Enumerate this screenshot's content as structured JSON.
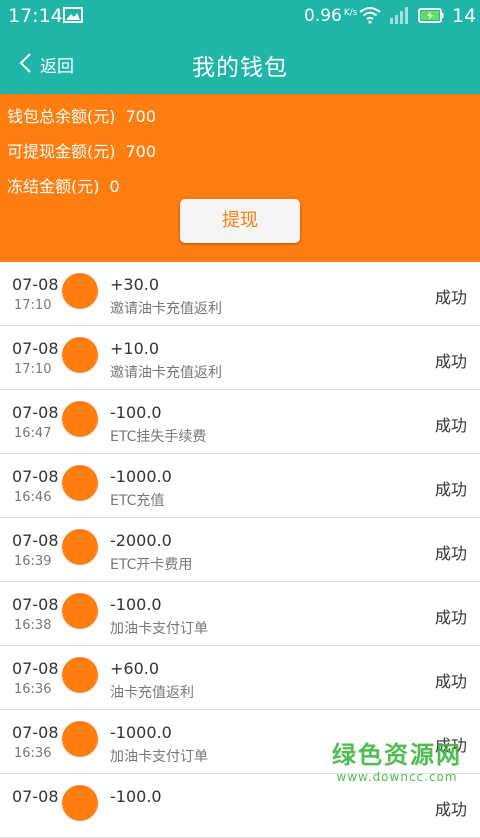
{
  "colors": {
    "header": "#1fb5a8",
    "accent": "#ff7e0f",
    "background": "#f2f2f2",
    "watermark": "#3fb53f"
  },
  "status_bar": {
    "time": "17:14",
    "net_speed": "0.96",
    "net_speed_unit": "K/s",
    "battery_level": "14",
    "icons": [
      "image-icon",
      "wifi-icon",
      "signal-icon",
      "battery-icon"
    ]
  },
  "nav": {
    "back_label": "返回",
    "title": "我的钱包",
    "back_icon": "chevron-left-icon"
  },
  "balance": {
    "total_label": "钱包总余额(元)",
    "total_value": "700",
    "withdrawable_label": "可提现金额(元)",
    "withdrawable_value": "700",
    "frozen_label": "冻结金额(元)",
    "frozen_value": "0",
    "withdraw_button": "提现"
  },
  "transactions": [
    {
      "date": "07-08",
      "time": "17:10",
      "amount": "+30.0",
      "desc": "邀请油卡充值返利",
      "status": "成功"
    },
    {
      "date": "07-08",
      "time": "17:10",
      "amount": "+10.0",
      "desc": "邀请油卡充值返利",
      "status": "成功"
    },
    {
      "date": "07-08",
      "time": "16:47",
      "amount": "-100.0",
      "desc": "ETC挂失手续费",
      "status": "成功"
    },
    {
      "date": "07-08",
      "time": "16:46",
      "amount": "-1000.0",
      "desc": "ETC充值",
      "status": "成功"
    },
    {
      "date": "07-08",
      "time": "16:39",
      "amount": "-2000.0",
      "desc": "ETC开卡费用",
      "status": "成功"
    },
    {
      "date": "07-08",
      "time": "16:38",
      "amount": "-100.0",
      "desc": "加油卡支付订单",
      "status": "成功"
    },
    {
      "date": "07-08",
      "time": "16:36",
      "amount": "+60.0",
      "desc": "油卡充值返利",
      "status": "成功"
    },
    {
      "date": "07-08",
      "time": "16:36",
      "amount": "-1000.0",
      "desc": "加油卡支付订单",
      "status": "成功"
    },
    {
      "date": "07-08",
      "time": "",
      "amount": "-100.0",
      "desc": "",
      "status": "成功"
    }
  ],
  "watermark": {
    "cn": "绿色资源网",
    "url": "www.downcc.com"
  }
}
